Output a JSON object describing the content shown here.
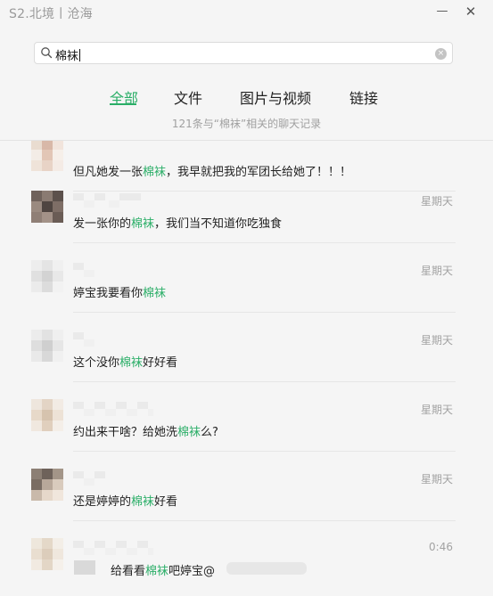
{
  "window": {
    "title": "S2.北境丨沧海",
    "minimize": "—",
    "close": "✕"
  },
  "search": {
    "query": "棉袜",
    "clear": "×"
  },
  "tabs": [
    {
      "label": "全部",
      "active": true
    },
    {
      "label": "文件",
      "active": false
    },
    {
      "label": "图片与视频",
      "active": false
    },
    {
      "label": "链接",
      "active": false
    }
  ],
  "summary": "121条与“棉袜”相关的聊天记录",
  "colors": {
    "accent": "#2aae67"
  },
  "results": [
    {
      "time": "",
      "pre": "但凡她发一张",
      "keyword": "棉袜",
      "post": "，我早就把我的军团长给她了！！！"
    },
    {
      "time": "星期天",
      "pre": "发一张你的",
      "keyword": "棉袜",
      "post": "，我们当不知道你吃独食"
    },
    {
      "time": "星期天",
      "pre": "婷宝我要看你",
      "keyword": "棉袜",
      "post": ""
    },
    {
      "time": "星期天",
      "pre": "这个没你",
      "keyword": "棉袜",
      "post": "好好看"
    },
    {
      "time": "星期天",
      "pre": "约出来干啥？给她洗",
      "keyword": "棉袜",
      "post": "么?"
    },
    {
      "time": "星期天",
      "pre": "还是婷婷的",
      "keyword": "棉袜",
      "post": "好看"
    },
    {
      "time": "0:46",
      "pre": "给看看",
      "keyword": "棉袜",
      "post": "吧婷宝@"
    }
  ]
}
